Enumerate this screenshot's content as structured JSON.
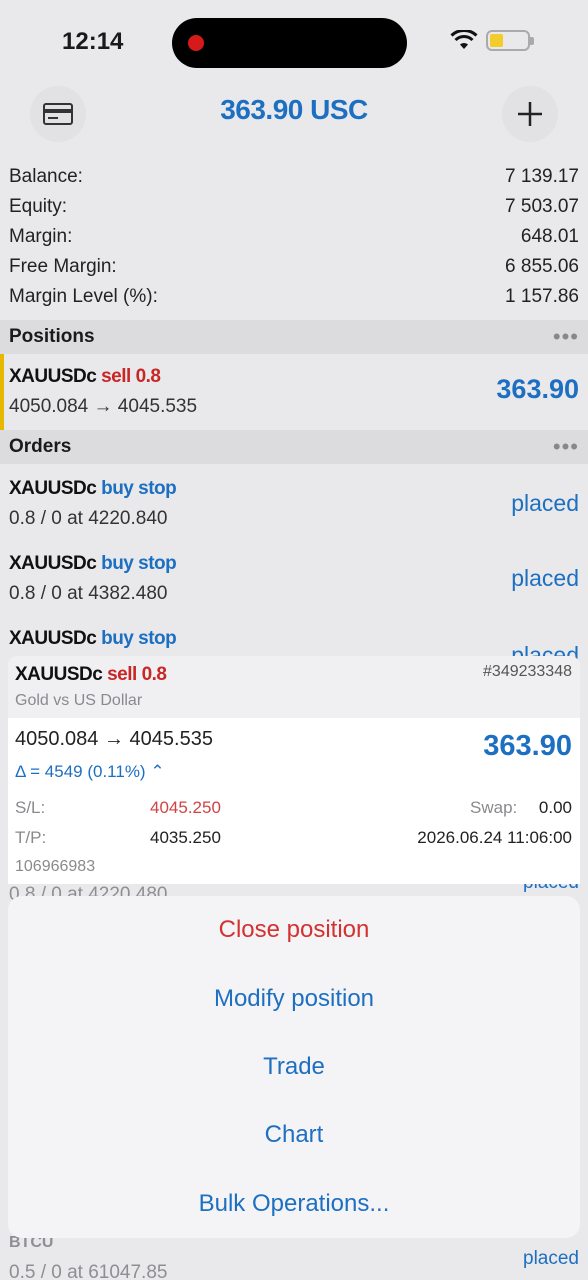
{
  "status_bar": {
    "time": "12:14"
  },
  "header": {
    "title": "363.90 USC"
  },
  "summary": [
    {
      "label": "Balance:",
      "value": "7 139.17"
    },
    {
      "label": "Equity:",
      "value": "7 503.07"
    },
    {
      "label": "Margin:",
      "value": "648.01"
    },
    {
      "label": "Free Margin:",
      "value": "6 855.06"
    },
    {
      "label": "Margin Level (%):",
      "value": "1 157.86"
    }
  ],
  "positions": {
    "title": "Positions",
    "more": "•••",
    "items": [
      {
        "symbol": "XAUUSDc",
        "side": "sell 0.8",
        "detail": "4050.084 → 4045.535",
        "profit": "363.90"
      }
    ]
  },
  "orders": {
    "title": "Orders",
    "more": "•••",
    "items": [
      {
        "symbol": "XAUUSDc",
        "side": "buy stop",
        "detail": "0.8 / 0 at 4220.840",
        "state": "placed"
      },
      {
        "symbol": "XAUUSDc",
        "side": "buy stop",
        "detail": "0.8 / 0 at 4382.480",
        "state": "placed"
      },
      {
        "symbol": "XAUUSDc",
        "side": "buy stop",
        "detail": "",
        "state": "placed"
      }
    ]
  },
  "card": {
    "symbol": "XAUUSDc",
    "side": "sell 0.8",
    "ticket": "#349233348",
    "description": "Gold vs US Dollar",
    "prices": "4050.084 → 4045.535",
    "profit": "363.90",
    "delta": "Δ = 4549 (0.11%) ⌃",
    "sl_label": "S/L:",
    "sl_value": "4045.250",
    "swap_label": "Swap:",
    "swap_value": "0.00",
    "tp_label": "T/P:",
    "tp_value": "4035.250",
    "open_time": "2026.06.24 11:06:00",
    "id": "106966983"
  },
  "peek": {
    "below_card": "0.8 / 0 at 4220.480",
    "below_card_right": "placed",
    "bottom_symbol": "BTCU",
    "bottom_detail": "0.5 / 0 at 61047.85",
    "bottom_right": "placed"
  },
  "actions": [
    {
      "label": "Close position",
      "style": "destructive"
    },
    {
      "label": "Modify position",
      "style": "default"
    },
    {
      "label": "Trade",
      "style": "default"
    },
    {
      "label": "Chart",
      "style": "default"
    },
    {
      "label": "Bulk Operations...",
      "style": "default"
    }
  ],
  "colors": {
    "accent": "#1d6fc2",
    "sell": "#c82727",
    "position_bar": "#e6b800"
  }
}
